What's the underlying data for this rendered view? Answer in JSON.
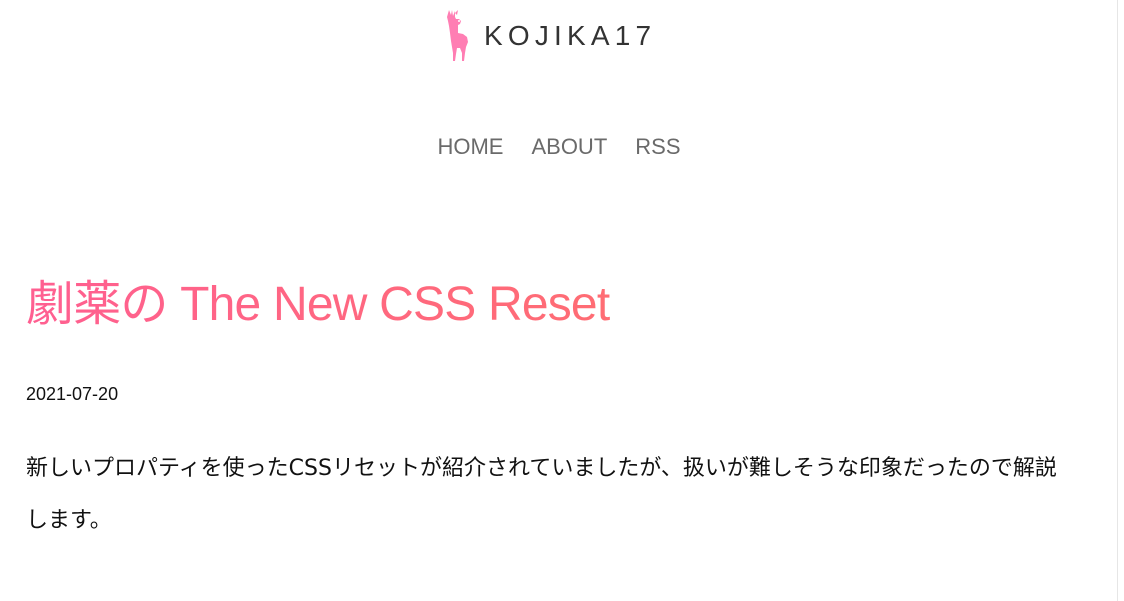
{
  "header": {
    "logo_text": "KOJIKA17",
    "logo_icon": "deer-icon",
    "logo_color": "#ff7eb3"
  },
  "nav": {
    "items": [
      {
        "label": "HOME"
      },
      {
        "label": "ABOUT"
      },
      {
        "label": "RSS"
      }
    ]
  },
  "article": {
    "title": "劇薬の The New CSS Reset",
    "date": "2021-07-20",
    "intro": "新しいプロパティを使ったCSSリセットが紹介されていましたが、扱いが難しそうな印象だったので解説します。"
  },
  "colors": {
    "title_gradient_start": "#ff5f91",
    "title_gradient_end": "#ff8a5a",
    "nav_text": "#6a6a6a",
    "logo_text": "#333333"
  }
}
